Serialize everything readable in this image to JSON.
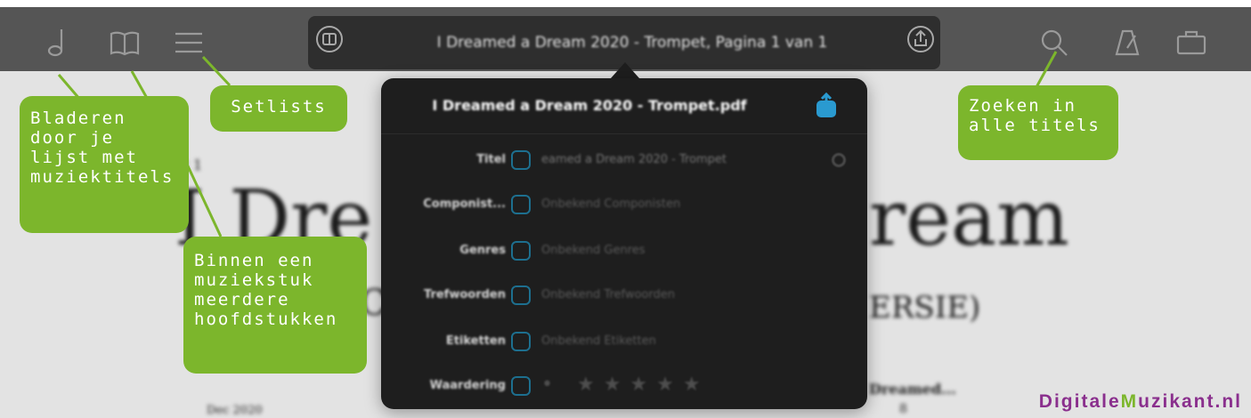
{
  "toolbar": {
    "document_title": "I Dreamed a Dream 2020 - Trompet, Pagina 1 van 1",
    "icons": [
      "music-note-icon",
      "book-icon",
      "menu-icon",
      "two-page-icon",
      "share-icon",
      "search-icon",
      "metronome-icon",
      "briefcase-icon"
    ]
  },
  "background": {
    "page_marker": "et 1",
    "title_fragment_left": "I Dre",
    "title_fragment_right": "ream",
    "subtitle_left": "C",
    "subtitle_right": "ERSIE)",
    "footer_left": "Dec 2020",
    "footer_mid": "Dreamed...",
    "footer_num": "8"
  },
  "popover": {
    "filename": "I Dreamed a Dream 2020 - Trompet.pdf",
    "rows": [
      {
        "label": "Titel",
        "value": "eamed a Dream 2020 - Trompet"
      },
      {
        "label": "Componist...",
        "value": "Onbekend Componisten"
      },
      {
        "label": "Genres",
        "value": "Onbekend Genres"
      },
      {
        "label": "Trefwoorden",
        "value": "Onbekend Trefwoorden"
      },
      {
        "label": "Etiketten",
        "value": "Onbekend Etiketten"
      },
      {
        "label": "Waardering",
        "value": "• ★★★★★"
      }
    ]
  },
  "callouts": {
    "bladeren": "Bladeren door je lijst met muziektitels",
    "setlists": "Setlists",
    "binnen": "Binnen een muziekstuk meerdere hoofdstukken",
    "zoeken": "Zoeken in alle titels"
  },
  "brand": {
    "part1": "Digitale",
    "part2": "M",
    "part3": "uzikant.nl"
  },
  "colors": {
    "toolbar": "#555555",
    "popover": "#1e1e1e",
    "callout": "#7cb62c",
    "checkbox": "#1d6f8f",
    "brand_purple": "#8a2f8d"
  }
}
